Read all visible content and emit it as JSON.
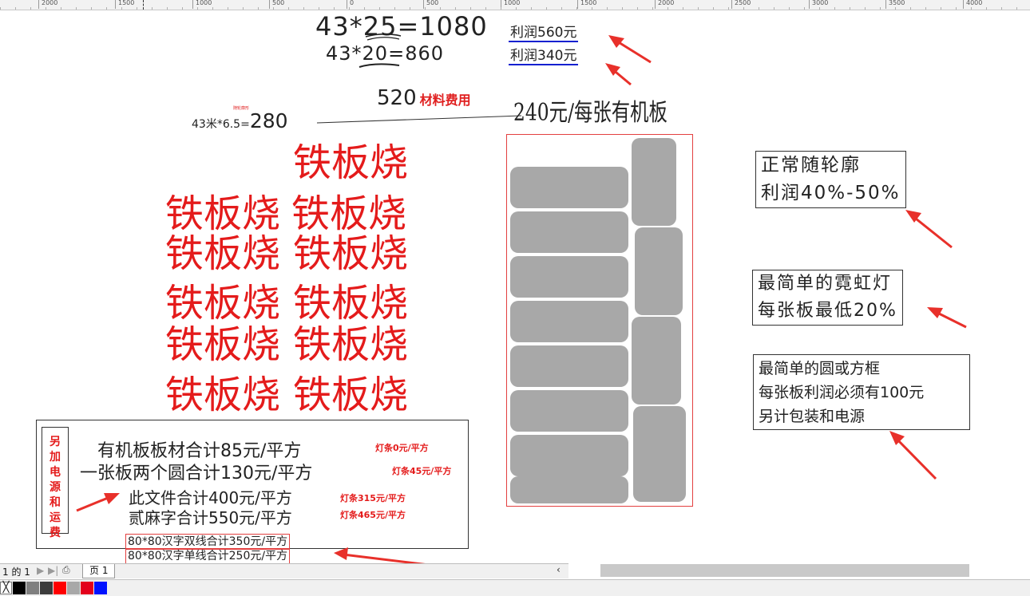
{
  "ruler": {
    "labels": [
      "2000",
      "1500",
      "1000",
      "500",
      "0",
      "500",
      "1000",
      "1500",
      "2000",
      "2500",
      "3000",
      "3500",
      "4000"
    ]
  },
  "formulas": {
    "line1": "43*25=1080",
    "line2": "43*20=860",
    "line3_value": "520",
    "line3_label": "材料费用",
    "line4_prefix": "43米*6.5=",
    "line4_value": "280",
    "tiny_note": "随轮廓形",
    "profit1": "利润560元",
    "profit2": "利润340元",
    "per_board": "240元/每张有机板"
  },
  "red_text": "铁板烧",
  "notes": {
    "contour": [
      "正常随轮廓",
      "利润40%-50%"
    ],
    "neon": [
      "最简单的霓虹灯",
      "每张板最低20%"
    ],
    "simple": [
      "最简单的圆或方框",
      "每张板利润必须有100元",
      "另计包装和电源"
    ]
  },
  "price_box": {
    "side_label": "另加电源和运费",
    "lines": [
      {
        "text": "有机板板材合计85元/平方",
        "extra": "灯条0元/平方"
      },
      {
        "text": "一张板两个圆合计130元/平方",
        "extra": "灯条45元/平方"
      },
      {
        "text": "此文件合计400元/平方",
        "extra": "灯条315元/平方"
      },
      {
        "text": "贰麻字合计550元/平方",
        "extra": "灯条465元/平方"
      }
    ],
    "sub_lines": [
      "80*80汉字双线合计350元/平方",
      "80*80汉字单线合计250元/平方"
    ]
  },
  "status": {
    "page_info": "1 的 1",
    "page_tab": "页 1",
    "scroll_left": "‹"
  },
  "palette_colors": [
    "#000000",
    "#7f7f7f",
    "#3c3c3c",
    "#ff0000",
    "#a8a8a8",
    "#e3001b",
    "#0012ff"
  ],
  "arrow_color": "#e8302a"
}
